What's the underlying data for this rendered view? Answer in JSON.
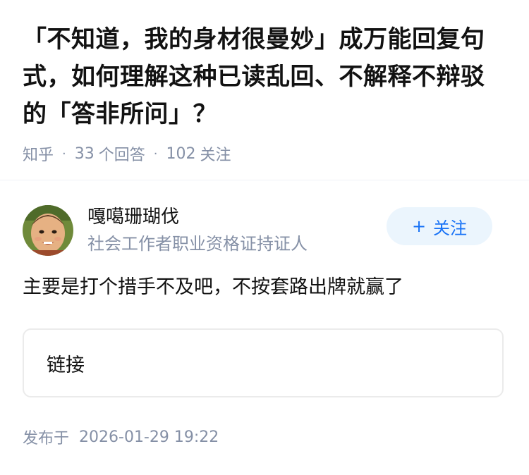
{
  "question": {
    "title": "「不知道，我的身材很曼妙」成万能回复句式，如何理解这种已读乱回、不解释不辩驳的「答非所问」？",
    "source": "知乎",
    "answer_count": "33",
    "answer_label": "个回答",
    "follow_count": "102",
    "follow_label": "关注"
  },
  "answer": {
    "author": {
      "name": "嘎噶珊瑚伐",
      "badge": "社会工作者职业资格证持证人",
      "avatar_icon": "avatar-photo"
    },
    "follow_button": {
      "plus": "+",
      "label": "关注"
    },
    "content": "主要是打个措手不及吧，不按套路出牌就赢了",
    "link_card": {
      "label": "链接"
    },
    "published": {
      "label": "发布于",
      "time": "2026-01-29 19:22"
    }
  },
  "colors": {
    "meta_gray": "#8590a6",
    "follow_bg": "#ebf5fd",
    "follow_text": "#1772f6",
    "text": "#121212"
  }
}
